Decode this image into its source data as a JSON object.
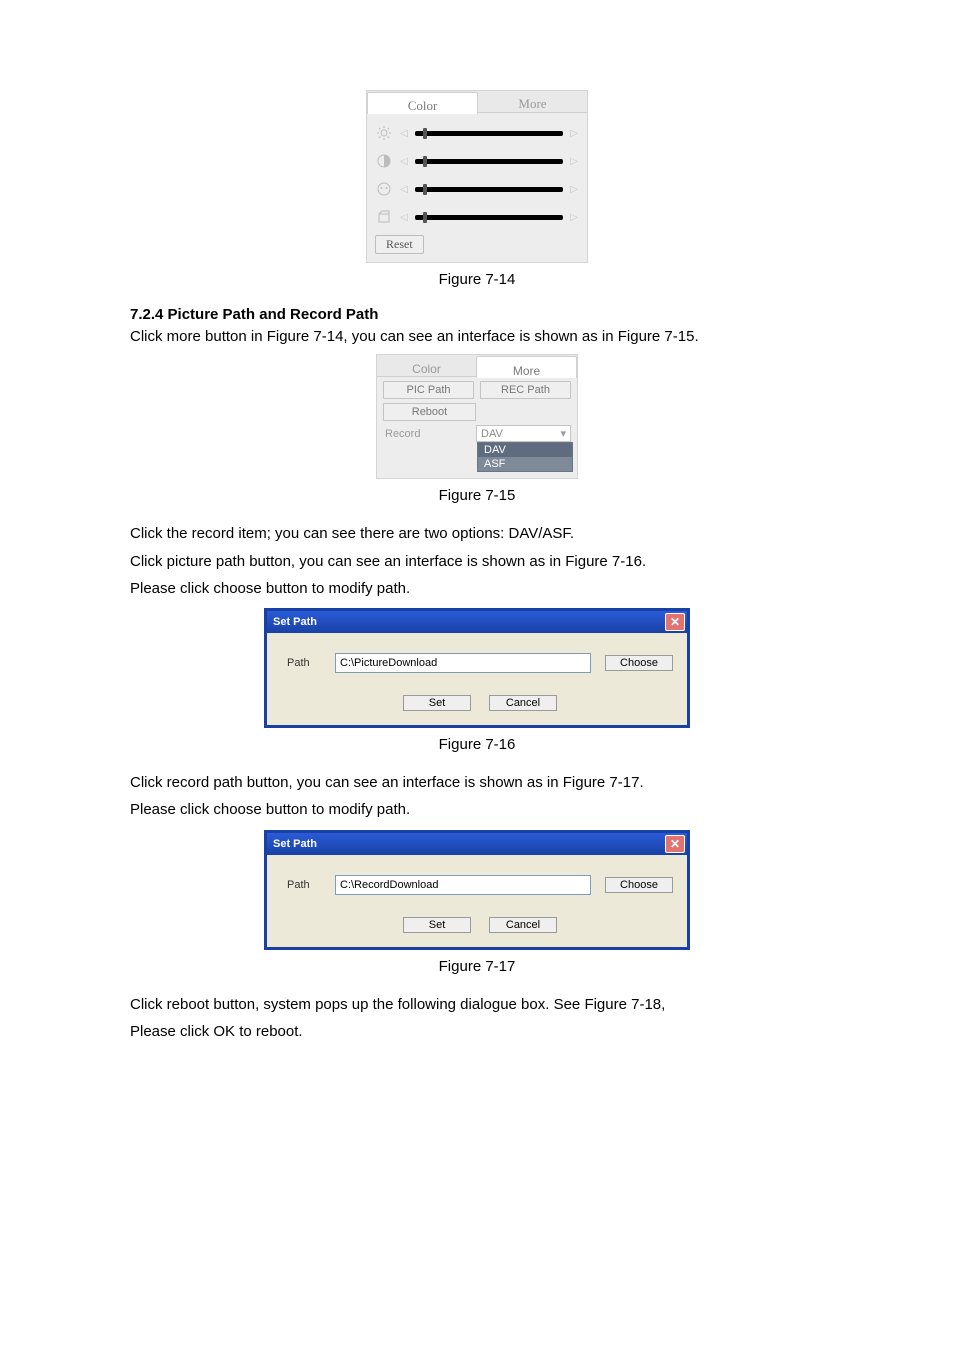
{
  "fig14": {
    "caption": "Figure 7-14",
    "tab_color": "Color",
    "tab_more": "More",
    "reset": "Reset",
    "thumbs": [
      8,
      8,
      8,
      8
    ]
  },
  "heading": "7.2.4  Picture Path and Record Path",
  "p1": "Click more button in Figure 7-14, you can see an interface is shown as in Figure 7-15.",
  "fig15": {
    "caption": "Figure 7-15",
    "tab_color": "Color",
    "tab_more": "More",
    "pic_path": "PIC Path",
    "rec_path": "REC Path",
    "reboot": "Reboot",
    "record": "Record",
    "selected": "DAV",
    "opt1": "DAV",
    "opt2": "ASF"
  },
  "p2": "Click the record item; you can see there are two options: DAV/ASF.",
  "p3": "Click picture path button, you can see an interface is shown as in Figure 7-16.",
  "p4": "Please click choose button to modify path.",
  "fig16": {
    "caption": "Figure 7-16",
    "title": "Set Path",
    "path_label": "Path",
    "path_value": "C:\\PictureDownload",
    "choose": "Choose",
    "set": "Set",
    "cancel": "Cancel"
  },
  "p5": "Click record path button, you can see an interface is shown as in Figure 7-17.",
  "p6": "Please click choose button to modify path.",
  "fig17": {
    "caption": "Figure 7-17",
    "title": "Set Path",
    "path_label": "Path",
    "path_value": "C:\\RecordDownload",
    "choose": "Choose",
    "set": "Set",
    "cancel": "Cancel"
  },
  "p7": "Click reboot button, system pops up the following dialogue box. See Figure 7-18,",
  "p8": "Please click OK to reboot."
}
